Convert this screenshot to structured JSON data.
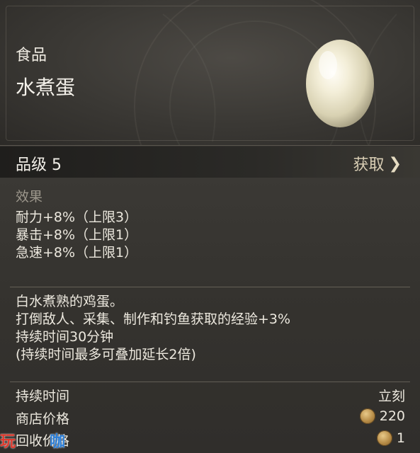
{
  "item": {
    "category": "食品",
    "name": "水煮蛋",
    "grade_label": "品级 5",
    "obtain_label": "获取",
    "chevron_icon": "chevron-right-icon"
  },
  "effects": {
    "title": "效果",
    "lines": [
      "耐力+8%（上限3）",
      "暴击+8%（上限1）",
      "急速+8%（上限1）"
    ]
  },
  "description": {
    "lines": [
      "白水煮熟的鸡蛋。",
      "打倒敌人、采集、制作和钓鱼获取的经验+3%",
      "持续时间30分钟",
      "(持续时间最多可叠加延长2倍)"
    ]
  },
  "meta": {
    "duration_label": "持续时间",
    "duration_value": "立刻",
    "shop_price_label": "商店价格",
    "shop_price_value": "220",
    "buyback_label": "回收价格",
    "buyback_value": "1",
    "coin_icon": "coin-icon"
  },
  "watermark": {
    "char1": "玩",
    "char2": "咖",
    "char3": "玩"
  },
  "colors": {
    "panel": "#33312e",
    "text": "#ece8de",
    "muted": "#9c978c",
    "obtain": "#d8cdb4",
    "coin": "#c49a50"
  }
}
